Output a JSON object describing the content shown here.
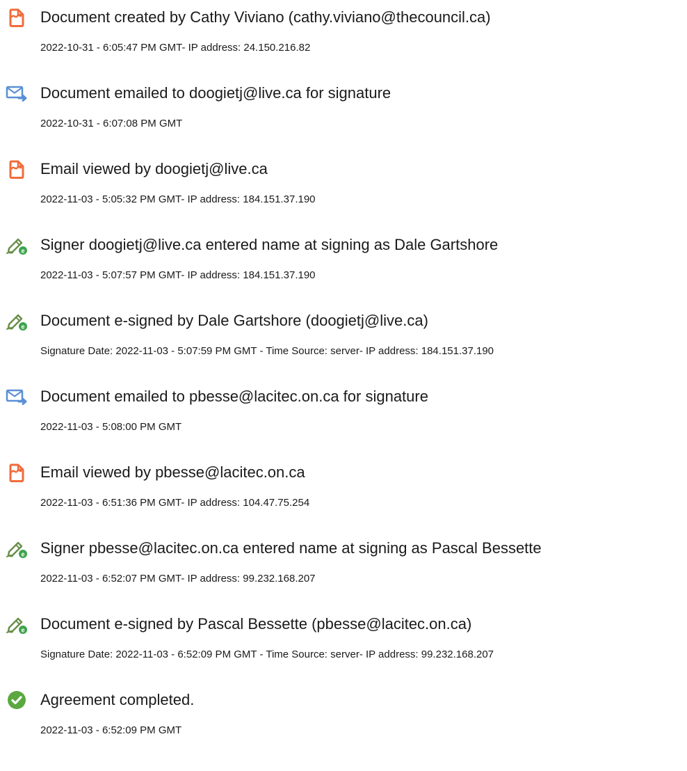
{
  "events": [
    {
      "icon": "document-created-icon",
      "title": "Document created by Cathy Viviano (cathy.viviano@thecouncil.ca)",
      "detail": "2022-10-31 - 6:05:47 PM GMT- IP address: 24.150.216.82"
    },
    {
      "icon": "email-sent-icon",
      "title": "Document emailed to doogietj@live.ca for signature",
      "detail": "2022-10-31 - 6:07:08 PM GMT"
    },
    {
      "icon": "document-viewed-icon",
      "title": "Email viewed by doogietj@live.ca",
      "detail": "2022-11-03 - 5:05:32 PM GMT- IP address: 184.151.37.190"
    },
    {
      "icon": "esign-pen-icon",
      "title": "Signer doogietj@live.ca entered name at signing as Dale Gartshore",
      "detail": "2022-11-03 - 5:07:57 PM GMT- IP address: 184.151.37.190"
    },
    {
      "icon": "esign-pen-icon",
      "title": "Document e-signed by Dale Gartshore (doogietj@live.ca)",
      "detail": "Signature Date: 2022-11-03 - 5:07:59 PM GMT - Time Source: server- IP address: 184.151.37.190"
    },
    {
      "icon": "email-sent-icon",
      "title": "Document emailed to pbesse@lacitec.on.ca for signature",
      "detail": "2022-11-03 - 5:08:00 PM GMT"
    },
    {
      "icon": "document-viewed-icon",
      "title": "Email viewed by pbesse@lacitec.on.ca",
      "detail": "2022-11-03 - 6:51:36 PM GMT- IP address: 104.47.75.254"
    },
    {
      "icon": "esign-pen-icon",
      "title": "Signer pbesse@lacitec.on.ca entered name at signing as Pascal Bessette",
      "detail": "2022-11-03 - 6:52:07 PM GMT- IP address: 99.232.168.207"
    },
    {
      "icon": "esign-pen-icon",
      "title": "Document e-signed by Pascal Bessette (pbesse@lacitec.on.ca)",
      "detail": "Signature Date: 2022-11-03 - 6:52:09 PM GMT - Time Source: server- IP address: 99.232.168.207"
    },
    {
      "icon": "check-circle-icon",
      "title": "Agreement completed.",
      "detail": "2022-11-03 - 6:52:09 PM GMT"
    }
  ],
  "colors": {
    "document_icon": "#f26b3a",
    "email_icon": "#5a8fd6",
    "pen_icon": "#6a8f4a",
    "check_icon": "#5aa83f"
  }
}
